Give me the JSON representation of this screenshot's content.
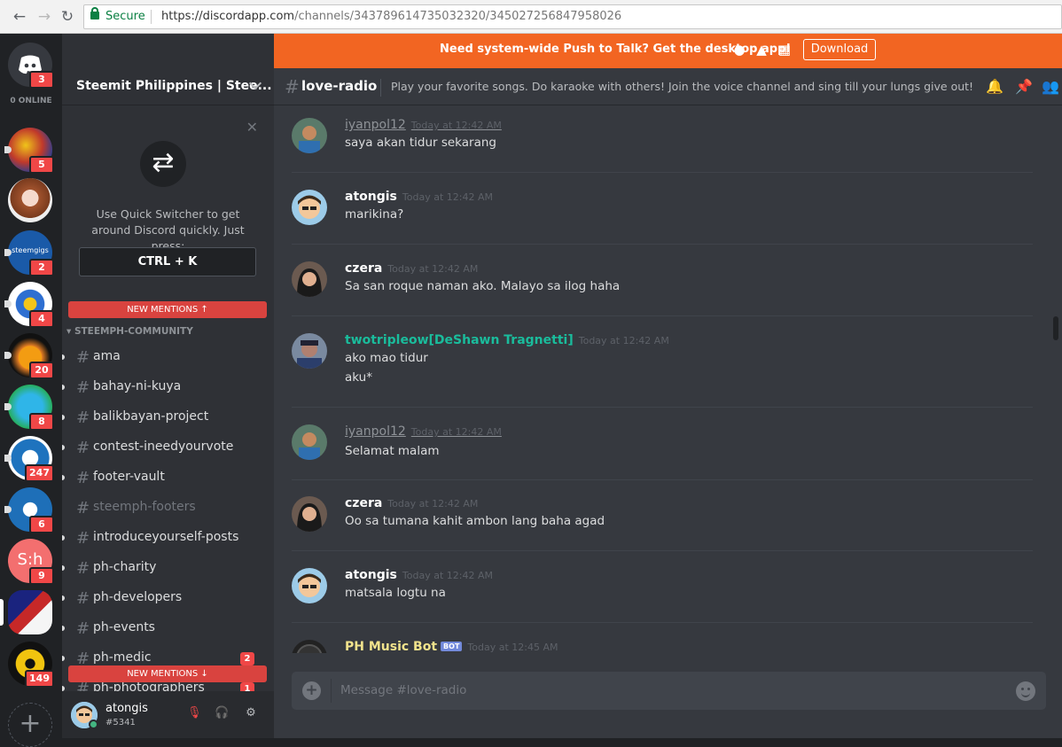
{
  "browser": {
    "secure_label": "Secure",
    "url_host": "https://discordapp.com",
    "url_path": "/channels/343789614735032320/345027256847958026"
  },
  "guilds": {
    "home_badge": "3",
    "online_label": "0 ONLINE",
    "items": [
      {
        "badge": "5"
      },
      {
        "badge": ""
      },
      {
        "label": "steemgigs",
        "badge": "2"
      },
      {
        "badge": "4"
      },
      {
        "badge": "20"
      },
      {
        "badge": "8"
      },
      {
        "badge": "247"
      },
      {
        "badge": "6"
      },
      {
        "label": "S:h",
        "badge": "9"
      },
      {
        "badge": ""
      },
      {
        "badge": "149"
      }
    ],
    "add_label": "+"
  },
  "sidebar": {
    "guild_name": "Steemit Philippines | Stee...",
    "switcher_text": "Use Quick Switcher to get around Discord quickly. Just press:",
    "switcher_key": "CTRL + K",
    "new_mentions_top": "NEW MENTIONS ↑",
    "new_mentions_bottom": "NEW MENTIONS ↓",
    "category": "STEEMPH-COMMUNITY",
    "channels": [
      {
        "name": "ama"
      },
      {
        "name": "bahay-ni-kuya"
      },
      {
        "name": "balikbayan-project"
      },
      {
        "name": "contest-ineedyourvote"
      },
      {
        "name": "footer-vault"
      },
      {
        "name": "steemph-footers"
      },
      {
        "name": "introduceyourself-posts"
      },
      {
        "name": "ph-charity"
      },
      {
        "name": "ph-developers"
      },
      {
        "name": "ph-events"
      },
      {
        "name": "ph-medic",
        "badge": "2"
      },
      {
        "name": "ph-photographers",
        "badge": "1"
      }
    ],
    "user": {
      "name": "atongis",
      "discriminator": "#5341"
    }
  },
  "promo": {
    "text": "Need system-wide Push to Talk? Get the desktop app!",
    "download_label": "Download"
  },
  "channel": {
    "name": "love-radio",
    "topic": "Play your favorite songs. Do karaoke with others! Join the voice channel and sing till your lungs give out!"
  },
  "messages": [
    {
      "author": "iyanpol12",
      "timestamp": "Today at 12:42 AM",
      "lines": [
        "saya akan tidur sekarang"
      ]
    },
    {
      "author": "atongis",
      "timestamp": "Today at 12:42 AM",
      "lines": [
        "marikina?"
      ]
    },
    {
      "author": "czera",
      "timestamp": "Today at 12:42 AM",
      "lines": [
        "Sa san roque naman ako. Malayo sa ilog haha"
      ]
    },
    {
      "author": "twotripleow[DeShawn Tragnetti]",
      "timestamp": "Today at 12:42 AM",
      "lines": [
        "ako mao tidur",
        "aku*"
      ]
    },
    {
      "author": "iyanpol12",
      "timestamp": "Today at 12:42 AM",
      "lines": [
        "Selamat malam"
      ]
    },
    {
      "author": "czera",
      "timestamp": "Today at 12:42 AM",
      "lines": [
        "Oo sa tumana kahit ambon lang baha agad"
      ]
    },
    {
      "author": "atongis",
      "timestamp": "Today at 12:42 AM",
      "lines": [
        "matsala logtu na"
      ]
    },
    {
      "author": "PH Music Bot",
      "bot_tag": "BOT",
      "timestamp": "Today at 12:45 AM",
      "lines": []
    }
  ],
  "composer": {
    "placeholder": "Message #love-radio"
  },
  "colors": {
    "promo_bar": "#f26522",
    "mention_red": "#f04747",
    "teal_author": "#1abc9c",
    "bot_author": "#f1e38c",
    "background": "#36393f"
  }
}
